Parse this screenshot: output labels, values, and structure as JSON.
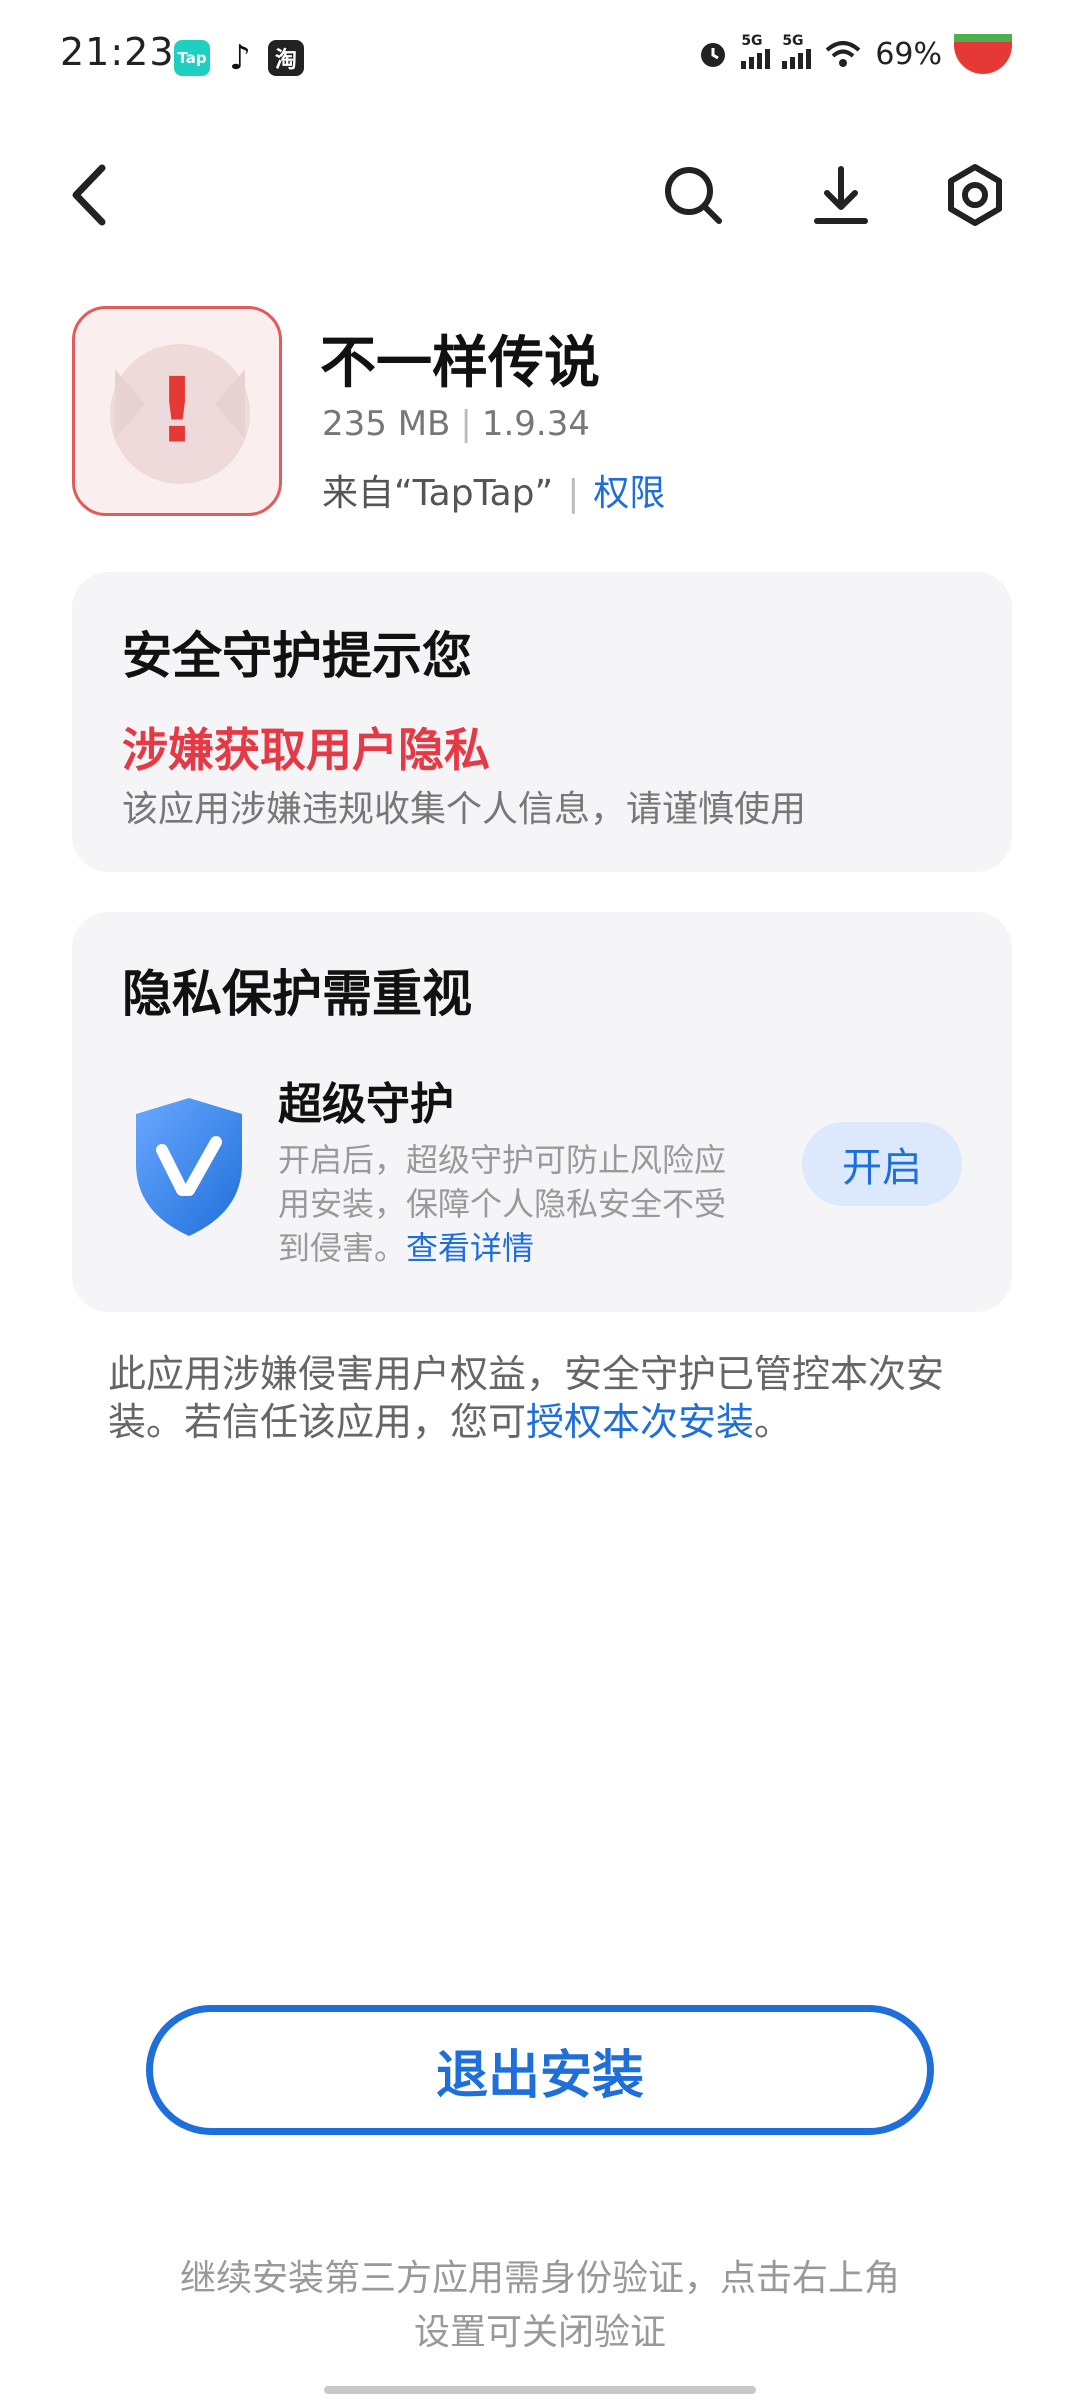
{
  "status_bar": {
    "time": "21:23",
    "app_icons": [
      {
        "name": "taptap-icon",
        "label": "Tap"
      },
      {
        "name": "tiktok-icon",
        "label": "♪"
      },
      {
        "name": "taobao-icon",
        "label": "淘"
      }
    ],
    "signal1_label": "5G",
    "signal2_label": "5G",
    "battery_text": "69%"
  },
  "app": {
    "name": "不一样传说",
    "size": "235 MB",
    "version": "1.9.34",
    "source": "来自“TapTap”",
    "permission_link": "权限"
  },
  "security_card": {
    "title": "安全守护提示您",
    "warning_title": "涉嫌获取用户隐私",
    "warning_desc": "该应用涉嫌违规收集个人信息，请谨慎使用"
  },
  "privacy_card": {
    "title": "隐私保护需重视",
    "feature_title": "超级守护",
    "feature_desc": "开启后，超级守护可防止风险应用安装，保障个人隐私安全不受到侵害。",
    "details_link": "查看详情",
    "open_button": "开启"
  },
  "notice": {
    "text": "此应用涉嫌侵害用户权益，安全守护已管控本次安装。若信任该应用，您可",
    "link": "授权本次安装",
    "end": "。"
  },
  "exit_button": "退出安装",
  "footer_text": "继续安装第三方应用需身份验证，点击右上角设置可关闭验证",
  "colors": {
    "accent": "#1e6fd9",
    "danger": "#e53945",
    "card_bg": "#f5f5f7"
  }
}
